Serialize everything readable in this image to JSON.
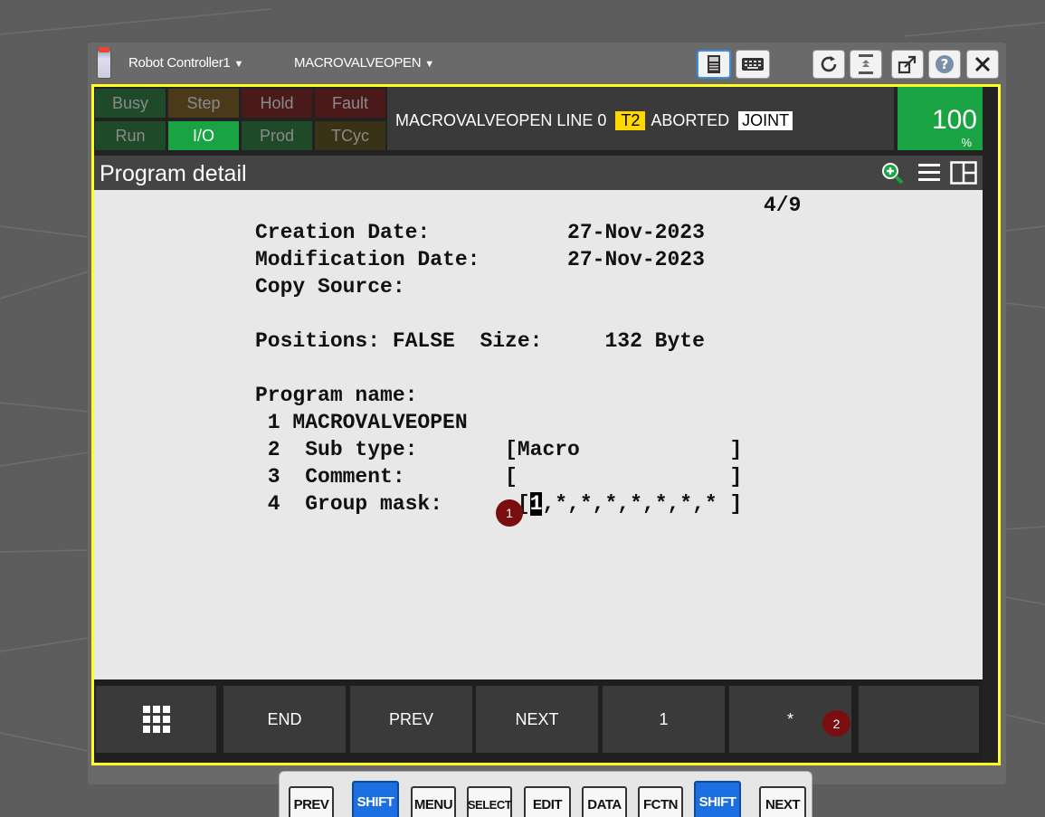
{
  "window": {
    "controller_label": "Robot Controller1",
    "program_label": "MACROVALVEOPEN"
  },
  "status": {
    "cells": [
      {
        "label": "Busy",
        "bg": "#1f4a2a",
        "fg": "#8a8a8a"
      },
      {
        "label": "Step",
        "bg": "#4a3a1a",
        "fg": "#8a8a8a"
      },
      {
        "label": "Hold",
        "bg": "#4a1a1a",
        "fg": "#8a8a8a"
      },
      {
        "label": "Fault",
        "bg": "#4a1a1a",
        "fg": "#8a8a8a"
      },
      {
        "label": "Run",
        "bg": "#1f4a2a",
        "fg": "#8a8a8a"
      },
      {
        "label": "I/O",
        "bg": "#1aa343",
        "fg": "#ffffff"
      },
      {
        "label": "Prod",
        "bg": "#1f4a2a",
        "fg": "#8a8a8a"
      },
      {
        "label": "TCyc",
        "bg": "#3a3216",
        "fg": "#8a8a8a"
      }
    ],
    "message_prefix": "MACROVALVEOPEN LINE 0",
    "mode_badge": "T2",
    "state": "ABORTED",
    "coord_badge": "JOINT",
    "override_value": "100",
    "override_unit": "%"
  },
  "screen": {
    "title": "Program detail",
    "page": "4/9",
    "lines": [
      "Creation Date:           27-Nov-2023",
      "Modification Date:       27-Nov-2023",
      "Copy Source:",
      "Positions: FALSE  Size:     132 Byte",
      "Program name:",
      " 1 MACROVALVEOPEN",
      " 2  Sub type:       [Macro            ]",
      " 3  Comment:        [                 ]"
    ],
    "group_mask_label": " 4  Group mask:      [",
    "group_mask_cursor": "1",
    "group_mask_rest": ",*,*,*,*,*,*,* ]",
    "markers": [
      "1",
      "2"
    ]
  },
  "function_keys": [
    "END",
    "PREV",
    "NEXT",
    "1",
    "*",
    ""
  ],
  "hard_keys": [
    "PREV",
    "SHIFT",
    "MENU",
    "SELECT",
    "EDIT",
    "DATA",
    "FCTN",
    "SHIFT",
    "NEXT"
  ],
  "colors": {
    "frame": "#ffff22",
    "accent_green": "#1aa343",
    "mode_yellow": "#ffd800",
    "marker": "#7a0d10",
    "shift_key": "#1b6fe0"
  }
}
